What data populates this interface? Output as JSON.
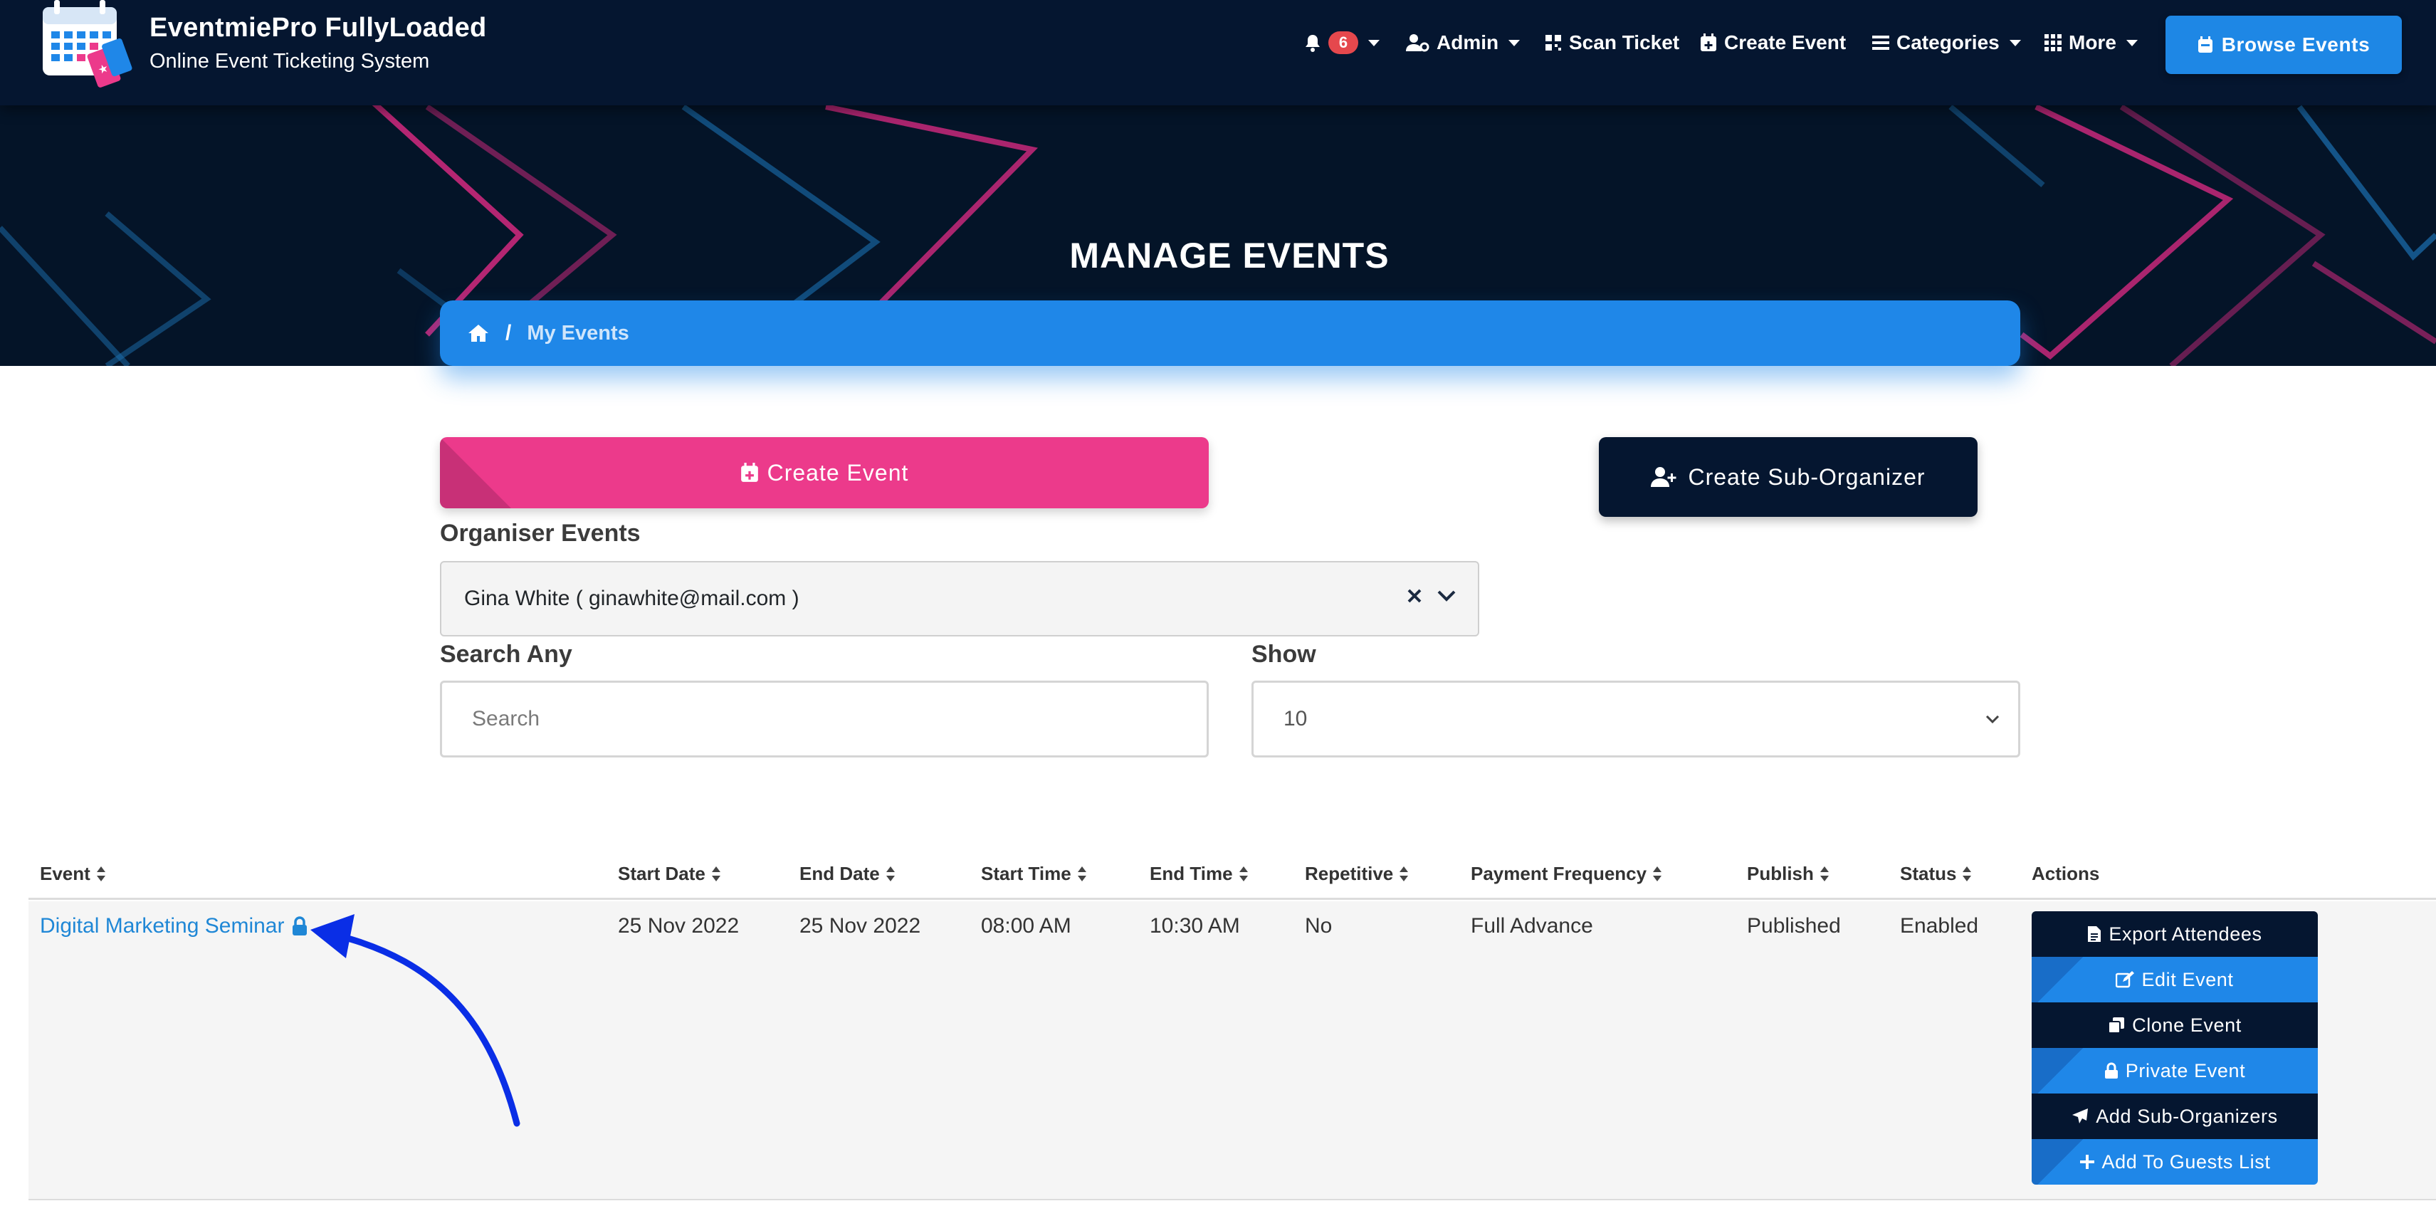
{
  "brand": {
    "title": "EventmiePro FullyLoaded",
    "subtitle": "Online Event Ticketing System"
  },
  "nav": {
    "notification_count": "6",
    "admin_label": "Admin",
    "scan_ticket_label": "Scan Ticket",
    "create_event_label": "Create Event",
    "categories_label": "Categories",
    "more_label": "More",
    "browse_events_label": "Browse Events"
  },
  "hero": {
    "title": "MANAGE EVENTS",
    "breadcrumb_current": "My Events"
  },
  "controls": {
    "create_event_label": "Create Event",
    "create_sub_organizer_label": "Create Sub-Organizer",
    "organiser_label": "Organiser Events",
    "organiser_value": "Gina White ( ginawhite@mail.com )",
    "search_label": "Search Any",
    "search_placeholder": "Search",
    "show_label": "Show",
    "show_value": "10"
  },
  "table": {
    "headers": {
      "event": "Event",
      "start_date": "Start Date",
      "end_date": "End Date",
      "start_time": "Start Time",
      "end_time": "End Time",
      "repetitive": "Repetitive",
      "payment_frequency": "Payment Frequency",
      "publish": "Publish",
      "status": "Status",
      "actions": "Actions"
    },
    "rows": [
      {
        "event": "Digital Marketing Seminar",
        "start_date": "25 Nov 2022",
        "end_date": "25 Nov 2022",
        "start_time": "08:00 AM",
        "end_time": "10:30 AM",
        "repetitive": "No",
        "payment_frequency": "Full Advance",
        "publish": "Published",
        "status": "Enabled",
        "actions": {
          "export_attendees": "Export Attendees",
          "edit_event": "Edit Event",
          "clone_event": "Clone Event",
          "private_event": "Private Event",
          "add_sub_organizers": "Add Sub-Organizers",
          "add_to_guests_list": "Add To Guests List"
        }
      }
    ]
  },
  "colors": {
    "navy": "#051630",
    "blue": "#1f87e8",
    "pink": "#ec3a8b",
    "link": "#1f87d6",
    "annotation_arrow": "#0a2ee6"
  }
}
